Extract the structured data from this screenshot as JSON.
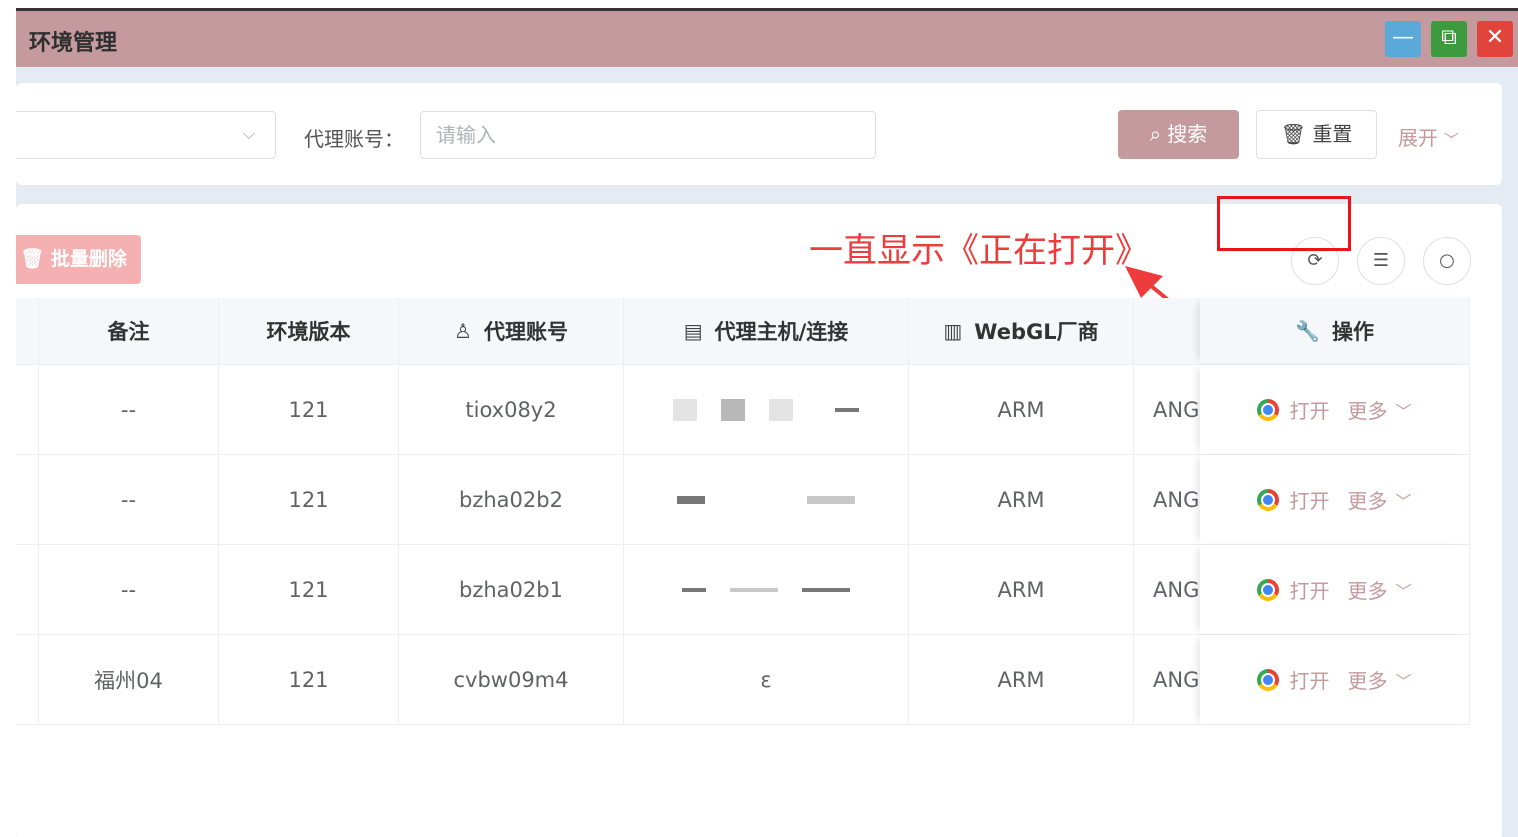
{
  "window": {
    "title": "环境管理",
    "minimize_label": "—",
    "restore_label": "⧉",
    "close_label": "✕"
  },
  "search": {
    "select_chevron": "⌵",
    "proxy_label": "代理账号：",
    "proxy_placeholder": "请输入",
    "search_button": "搜索",
    "reset_button": "重置",
    "expand_button": "展开"
  },
  "toolbar": {
    "batch_delete": "批量删除"
  },
  "annotation": {
    "text": "一直显示《正在打开》"
  },
  "table": {
    "columns": [
      "备注",
      "环境版本",
      "代理账号",
      "代理主机/连接",
      "WebGL厂商",
      "",
      "操作"
    ],
    "rows": [
      {
        "note": "--",
        "version": "121",
        "account": "tiox08y2",
        "host": "",
        "webgl": "ARM",
        "renderer": "ANG",
        "open": "打开",
        "more": "更多"
      },
      {
        "note": "--",
        "version": "121",
        "account": "bzha02b2",
        "host": "",
        "webgl": "ARM",
        "renderer": "ANG",
        "open": "打开",
        "more": "更多"
      },
      {
        "note": "--",
        "version": "121",
        "account": "bzha02b1",
        "host": "",
        "webgl": "ARM",
        "renderer": "ANG",
        "open": "打开",
        "more": "更多"
      },
      {
        "note": "福州04",
        "version": "121",
        "account": "cvbw09m4",
        "host": "ε",
        "webgl": "ARM",
        "renderer": "ANG",
        "open": "打开",
        "more": "更多"
      }
    ]
  },
  "colors": {
    "brand": "#c49a9e",
    "danger": "#e8161a",
    "annotation": "#ee3b3b",
    "batch_delete": "#f5b1b1"
  },
  "icons": [
    "search-icon",
    "trash-icon",
    "refresh-icon",
    "column-settings-icon",
    "zoom-icon",
    "user-icon",
    "server-icon",
    "building-icon",
    "wrench-icon",
    "chrome-icon",
    "chevron-down-icon"
  ]
}
